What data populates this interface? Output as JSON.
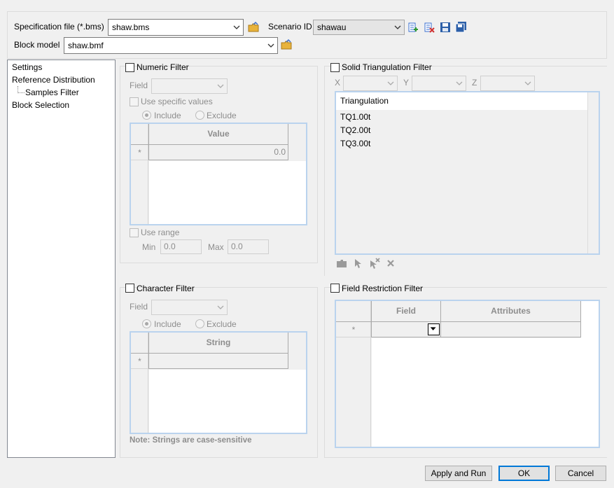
{
  "top": {
    "spec_label": "Specification file (*.bms)",
    "spec_value": "shaw.bms",
    "scenario_label": "Scenario ID",
    "scenario_value": "shawau",
    "block_label": "Block model",
    "block_value": "shaw.bmf"
  },
  "tree": {
    "items": [
      "Settings",
      "Reference Distribution",
      "Samples Filter",
      "Block Selection"
    ]
  },
  "numeric": {
    "title": "Numeric Filter",
    "field_label": "Field",
    "use_specific": "Use specific values",
    "include": "Include",
    "exclude": "Exclude",
    "col_header": "Value",
    "new_row_marker": "*",
    "new_row_value": "0.0",
    "use_range": "Use range",
    "min_label": "Min",
    "min_value": "0.0",
    "max_label": "Max",
    "max_value": "0.0"
  },
  "solid": {
    "title": "Solid Triangulation Filter",
    "x_label": "X",
    "y_label": "Y",
    "z_label": "Z",
    "list_header": "Triangulation",
    "items": [
      "TQ1.00t",
      "TQ2.00t",
      "TQ3.00t"
    ]
  },
  "character": {
    "title": "Character Filter",
    "field_label": "Field",
    "include": "Include",
    "exclude": "Exclude",
    "col_header": "String",
    "new_row_marker": "*",
    "note": "Note: Strings are case-sensitive"
  },
  "field_restriction": {
    "title": "Field Restriction Filter",
    "col_field": "Field",
    "col_attributes": "Attributes",
    "new_row_marker": "*"
  },
  "buttons": {
    "apply": "Apply and Run",
    "ok": "OK",
    "cancel": "Cancel"
  },
  "colors": {
    "grid_border": "#bad3ee",
    "default_button": "#0078d7",
    "folder": "#e8b33c"
  }
}
